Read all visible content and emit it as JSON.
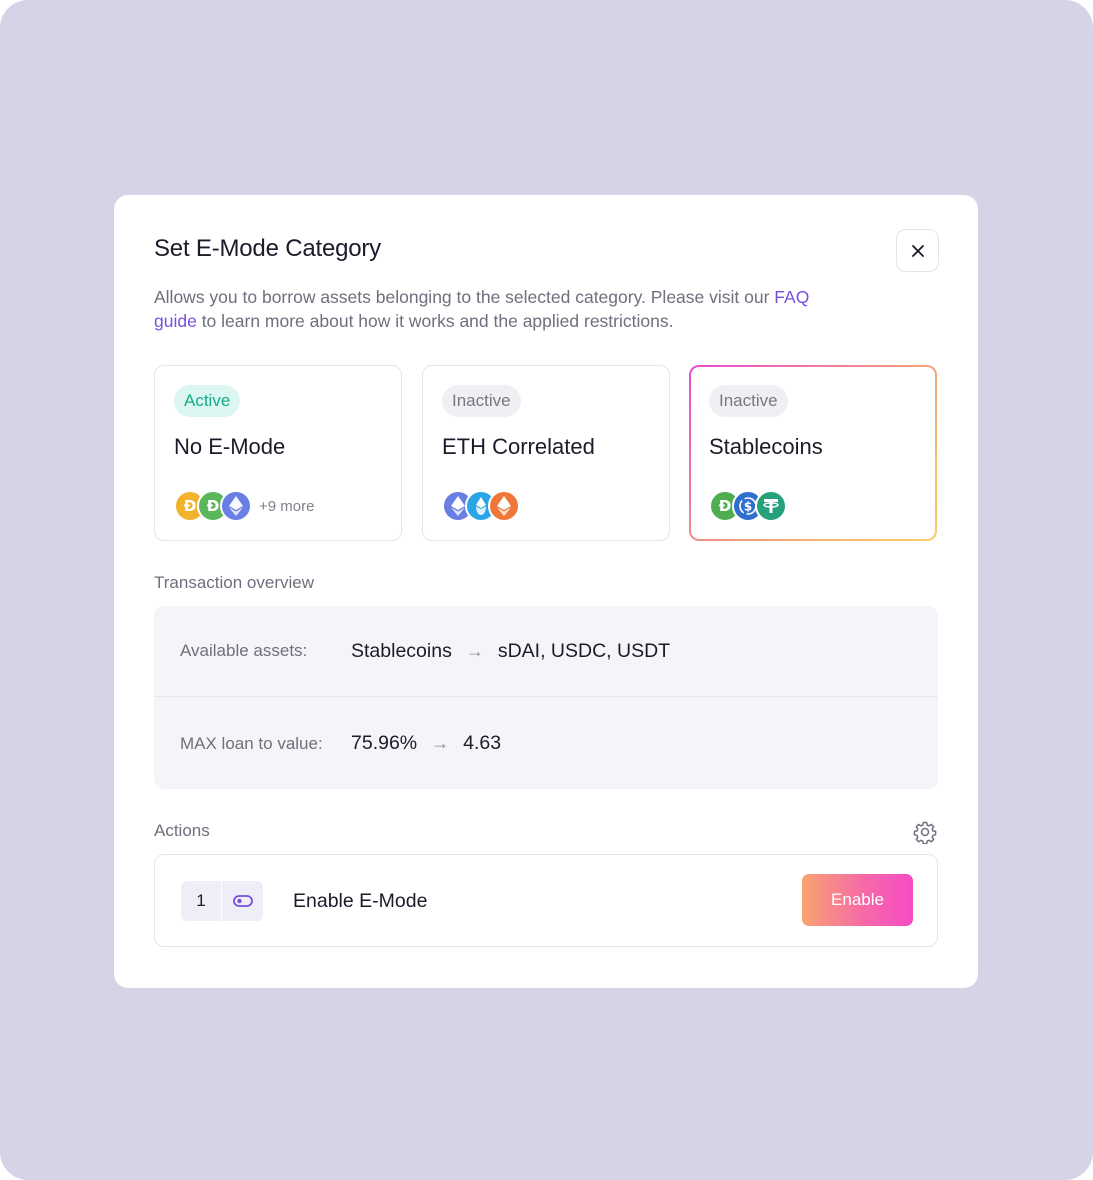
{
  "modal": {
    "title": "Set E-Mode Category",
    "description_before": "Allows you to borrow assets belonging to the selected category. Please visit our ",
    "description_link": "FAQ guide",
    "description_after": " to learn more about how it works and the applied restrictions."
  },
  "categories": [
    {
      "status": "Active",
      "name": "No E-Mode",
      "icons": [
        "dai-icon",
        "dai-icon",
        "eth-icon"
      ],
      "more": "+9 more",
      "selected": false
    },
    {
      "status": "Inactive",
      "name": "ETH Correlated",
      "icons": [
        "eth-icon",
        "wsteth-icon",
        "reth-icon"
      ],
      "selected": false
    },
    {
      "status": "Inactive",
      "name": "Stablecoins",
      "icons": [
        "sdai-icon",
        "usdc-icon",
        "usdt-icon"
      ],
      "selected": true
    }
  ],
  "overview": {
    "label": "Transaction overview",
    "available_assets": {
      "label": "Available assets:",
      "from": "Stablecoins",
      "to": "sDAI, USDC, USDT"
    },
    "max_ltv": {
      "label": "MAX loan to value:",
      "from": "75.96%",
      "to": "4.63"
    }
  },
  "actions": {
    "label": "Actions",
    "step_number": "1",
    "step_label": "Enable E-Mode",
    "button_label": "Enable"
  },
  "colors": {
    "backdrop": "#d5d4e6",
    "accent_link": "#7a4fe0",
    "active_badge_bg": "#dcf7f1",
    "active_badge_text": "#17a98b",
    "button_gradient": [
      "#f8a36f",
      "#f66aa7",
      "#f64bc4"
    ]
  }
}
